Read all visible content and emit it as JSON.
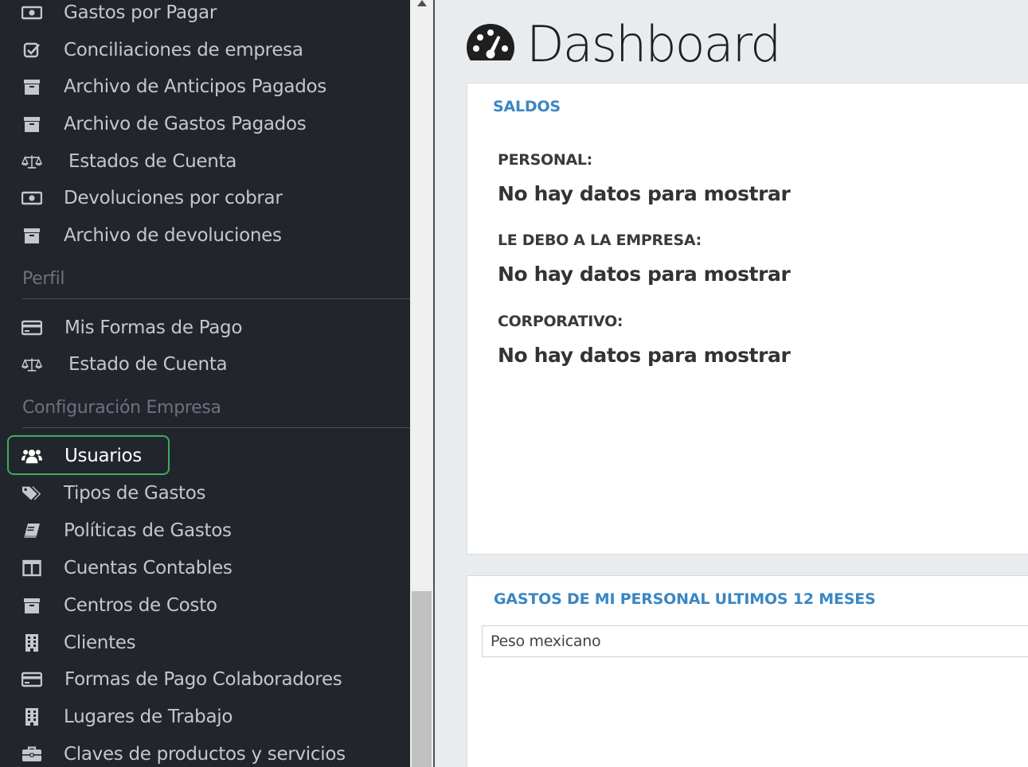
{
  "sidebar": {
    "items_top": [
      {
        "label": "Gastos por Pagar",
        "icon": "money-icon"
      },
      {
        "label": "Conciliaciones de empresa",
        "icon": "check-square-icon"
      },
      {
        "label": "Archivo de Anticipos Pagados",
        "icon": "archive-icon"
      },
      {
        "label": "Archivo de Gastos Pagados",
        "icon": "archive-icon"
      },
      {
        "label": "Estados de Cuenta",
        "icon": "balance-scale-icon"
      },
      {
        "label": "Devoluciones por cobrar",
        "icon": "money-icon"
      },
      {
        "label": "Archivo de devoluciones",
        "icon": "archive-icon"
      }
    ],
    "section_perfil": "Perfil",
    "items_perfil": [
      {
        "label": "Mis Formas de Pago",
        "icon": "credit-card-icon"
      },
      {
        "label": "Estado de Cuenta",
        "icon": "balance-scale-icon"
      }
    ],
    "section_config": "Configuración Empresa",
    "items_config": [
      {
        "label": "Usuarios",
        "icon": "users-icon"
      },
      {
        "label": "Tipos de Gastos",
        "icon": "tags-icon"
      },
      {
        "label": "Políticas de Gastos",
        "icon": "book-icon"
      },
      {
        "label": "Cuentas Contables",
        "icon": "columns-icon"
      },
      {
        "label": "Centros de Costo",
        "icon": "archive-icon"
      },
      {
        "label": "Clientes",
        "icon": "building-icon"
      },
      {
        "label": "Formas de Pago Colaboradores",
        "icon": "credit-card-icon"
      },
      {
        "label": "Lugares de Trabajo",
        "icon": "building-icon"
      },
      {
        "label": "Claves de productos y servicios",
        "icon": "briefcase-icon"
      }
    ],
    "active_item": "Usuarios",
    "highlight_color": "#3cae5c"
  },
  "main": {
    "title": "Dashboard",
    "title_icon": "dashboard-icon",
    "saldos": {
      "heading": "SALDOS",
      "rows": [
        {
          "label": "PERSONAL:",
          "value": "No hay datos para mostrar"
        },
        {
          "label": "LE DEBO A LA EMPRESA:",
          "value": "No hay datos para mostrar"
        },
        {
          "label": "CORPORATIVO:",
          "value": "No hay datos para mostrar"
        }
      ]
    },
    "gastos": {
      "heading": "GASTOS DE MI PERSONAL ULTIMOS 12 MESES",
      "currency_selected": "Peso mexicano"
    }
  },
  "colors": {
    "sidebar_bg": "#22252c",
    "accent_blue": "#3a87c3",
    "page_bg": "#e9ecef"
  }
}
